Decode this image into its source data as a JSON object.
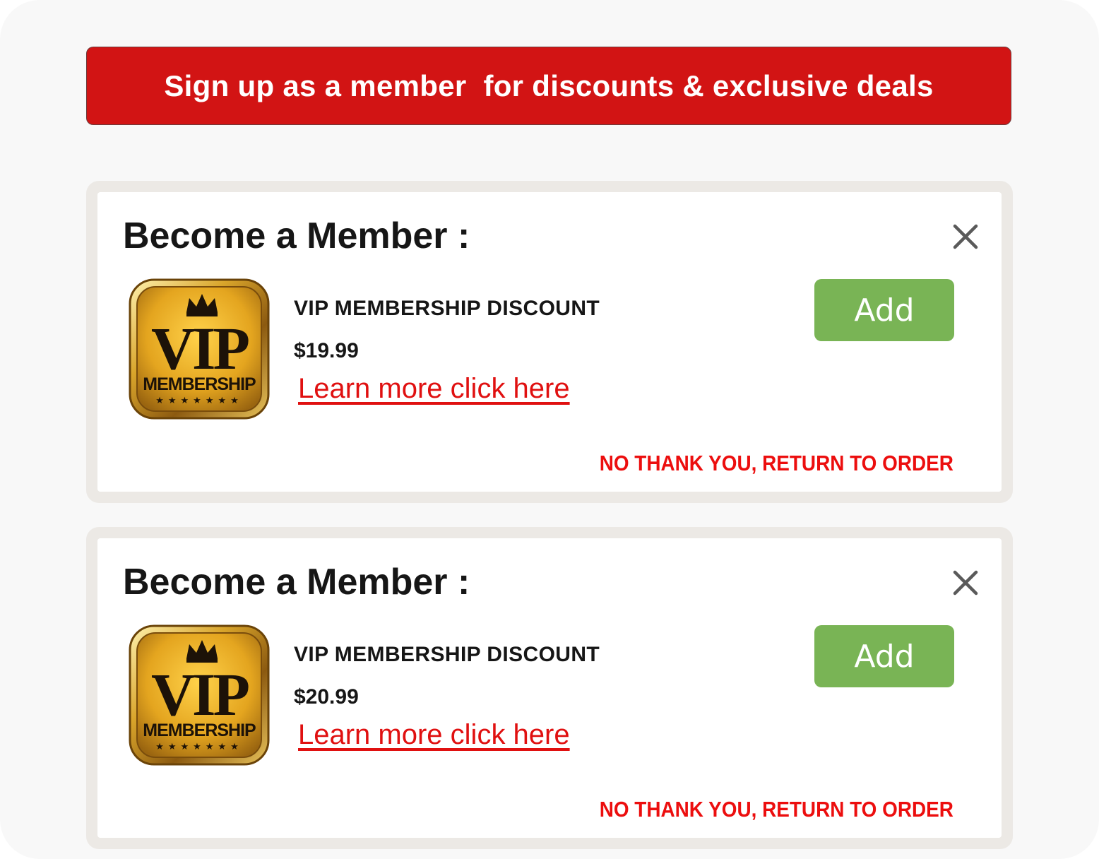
{
  "banner": {
    "text": "Sign up as a member  for discounts & exclusive deals"
  },
  "colors": {
    "banner": "#d21414",
    "add_button": "#79b455",
    "link": "#e01010",
    "decline": "#ec0e0e"
  },
  "offers": [
    {
      "title": "Become a Member :",
      "close_icon": "close-icon",
      "logo": {
        "icon": "vip-membership-badge",
        "big": "VIP",
        "small": "MEMBERSHIP"
      },
      "product_name": "VIP MEMBERSHIP DISCOUNT",
      "price": "$19.99",
      "learn_more": "Learn more click here",
      "add_label": "Add",
      "decline": "NO THANK YOU, RETURN TO ORDER"
    },
    {
      "title": "Become a Member :",
      "close_icon": "close-icon",
      "logo": {
        "icon": "vip-membership-badge",
        "big": "VIP",
        "small": "MEMBERSHIP"
      },
      "product_name": "VIP MEMBERSHIP DISCOUNT",
      "price": "$20.99",
      "learn_more": "Learn more click here",
      "add_label": "Add",
      "decline": "NO THANK YOU, RETURN TO ORDER"
    }
  ]
}
